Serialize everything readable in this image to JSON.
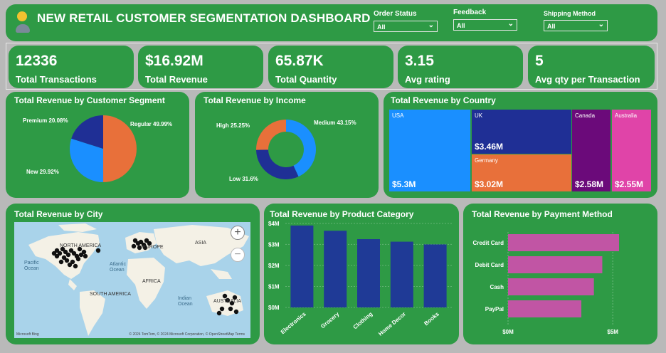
{
  "header": {
    "title": "NEW RETAIL CUSTOMER SEGMENTATION DASHBOARD",
    "filters": [
      {
        "label": "Order Status",
        "value": "All"
      },
      {
        "label": "Feedback",
        "value": "All"
      },
      {
        "label": "Shipping Method",
        "value": "All"
      }
    ]
  },
  "kpis": [
    {
      "value": "12336",
      "label": "Total Transactions"
    },
    {
      "value": "$16.92M",
      "label": "Total Revenue"
    },
    {
      "value": "65.87K",
      "label": "Total Quantity"
    },
    {
      "value": "3.15",
      "label": "Avg rating"
    },
    {
      "value": "5",
      "label": "Avg qty per Transaction"
    }
  ],
  "segment": {
    "title": "Total Revenue by Customer Segment",
    "slices": [
      {
        "name": "Regular",
        "label": "Regular 49.99%",
        "pct": 49.99,
        "color": "#e8703a"
      },
      {
        "name": "New",
        "label": "New 29.92%",
        "pct": 29.92,
        "color": "#1a8fff"
      },
      {
        "name": "Premium",
        "label": "Premium 20.08%",
        "pct": 20.08,
        "color": "#1f2f95"
      }
    ]
  },
  "income": {
    "title": "Total Revenue by Income",
    "slices": [
      {
        "name": "Medium",
        "label": "Medium 43.15%",
        "pct": 43.15,
        "color": "#1a8fff"
      },
      {
        "name": "Low",
        "label": "Low 31.6%",
        "pct": 31.6,
        "color": "#1f2f95"
      },
      {
        "name": "High",
        "label": "High 25.25%",
        "pct": 25.25,
        "color": "#e8703a"
      }
    ]
  },
  "country": {
    "title": "Total Revenue by Country",
    "items": [
      {
        "name": "USA",
        "amount": "$5.3M",
        "value": 5.3,
        "color": "#1a8fff"
      },
      {
        "name": "UK",
        "amount": "$3.46M",
        "value": 3.46,
        "color": "#1f2f95"
      },
      {
        "name": "Germany",
        "amount": "$3.02M",
        "value": 3.02,
        "color": "#e8703a"
      },
      {
        "name": "Canada",
        "amount": "$2.58M",
        "value": 2.58,
        "color": "#6b0a7a"
      },
      {
        "name": "Australia",
        "amount": "$2.55M",
        "value": 2.55,
        "color": "#e044a8"
      }
    ]
  },
  "city": {
    "title": "Total Revenue by City",
    "labels": {
      "north_america": "NORTH AMERICA",
      "europe": "EUROPE",
      "asia": "ASIA",
      "pacific": "Pacific",
      "ocean1": "Ocean",
      "atlantic": "Atlantic",
      "ocean2": "Ocean",
      "africa": "AFRICA",
      "south_america": "SOUTH AMERICA",
      "indian": "Indian",
      "ocean3": "Ocean",
      "australia": "AUSTRALIA"
    },
    "bing": "Microsoft Bing",
    "copyright": "© 2024 TomTom, © 2024 Microsoft Corporation, © OpenStreetMap  Terms",
    "zoom_in": "+",
    "zoom_out": "−"
  },
  "product": {
    "title": "Total Revenue by Product Category",
    "chart_data": {
      "type": "bar",
      "categories": [
        "Electronics",
        "Grocery",
        "Clothing",
        "Home Decor",
        "Books"
      ],
      "values": [
        3.9,
        3.65,
        3.25,
        3.13,
        3.0
      ],
      "yticks": [
        "$0M",
        "$1M",
        "$2M",
        "$3M",
        "$4M"
      ],
      "ylim": [
        0,
        4.2
      ],
      "color": "#1f3a96"
    }
  },
  "payment": {
    "title": "Total Revenue by Payment Method",
    "chart_data": {
      "type": "bar",
      "categories": [
        "Credit Card",
        "Debit Card",
        "Cash",
        "PayPal"
      ],
      "values": [
        5.3,
        4.5,
        4.1,
        3.5
      ],
      "xticks": [
        "$0M",
        "$5M"
      ],
      "xlim": [
        0,
        5.3
      ],
      "color": "#c155a4"
    }
  }
}
